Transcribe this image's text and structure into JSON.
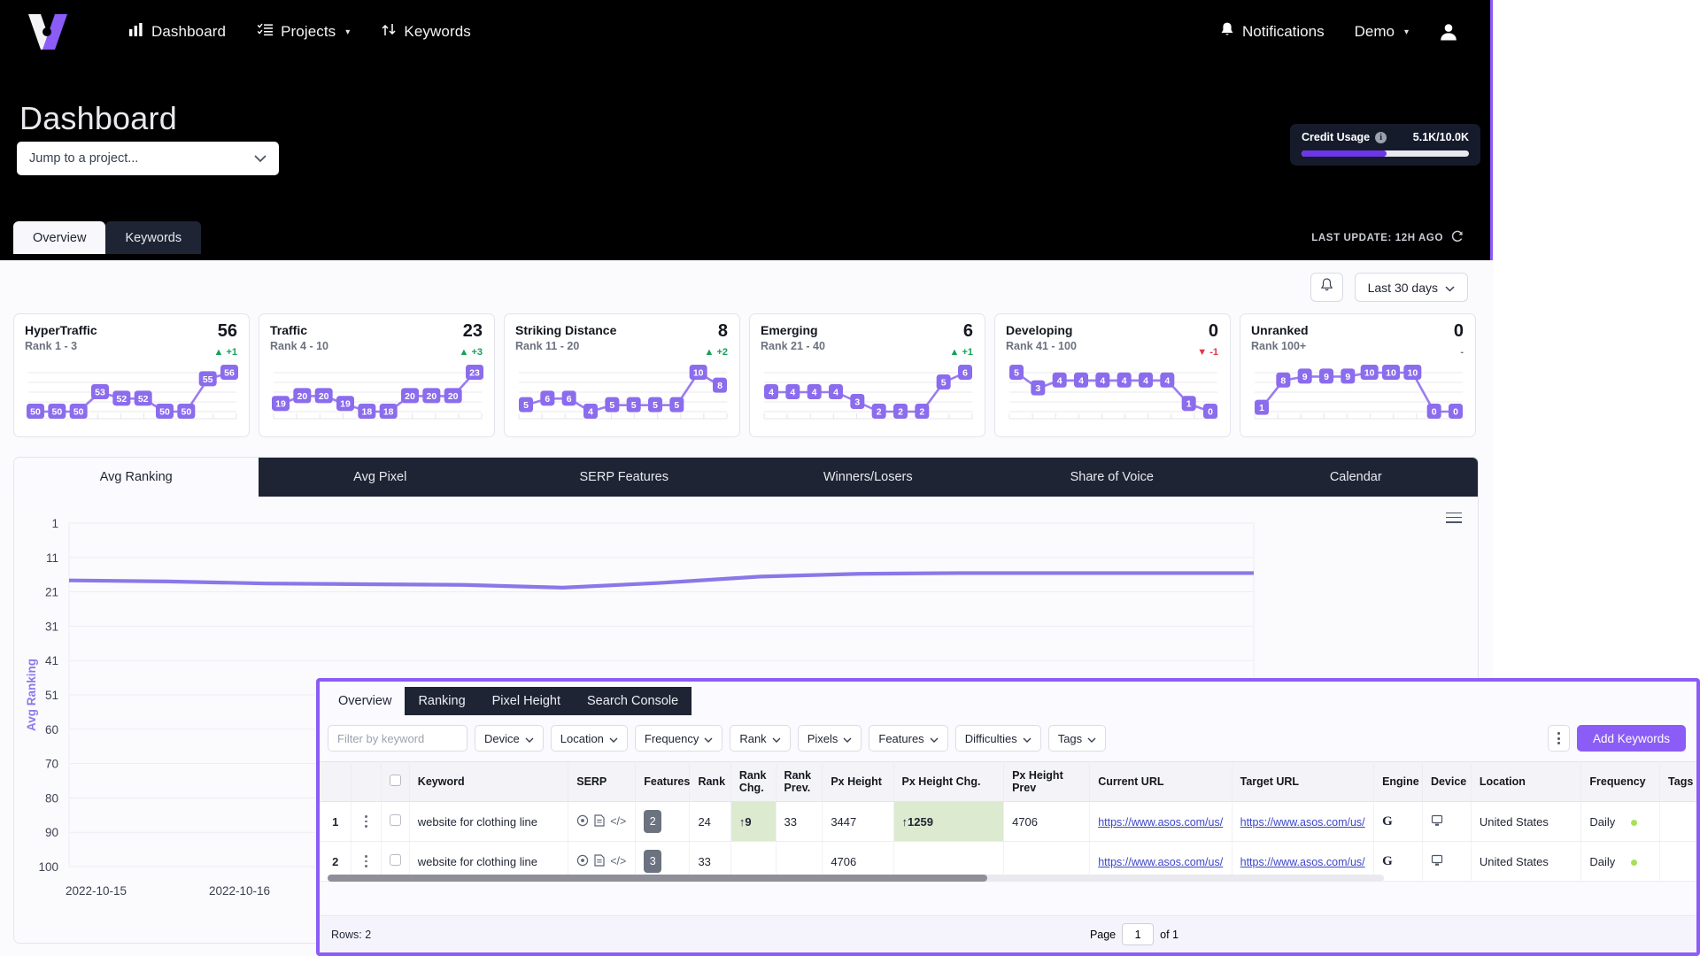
{
  "header": {
    "logo_name": "x-logo",
    "nav": [
      {
        "label": "Dashboard",
        "icon": "bar-chart-icon",
        "caret": false
      },
      {
        "label": "Projects",
        "icon": "list-check-icon",
        "caret": true,
        "caret_glyph": "▾"
      },
      {
        "label": "Keywords",
        "icon": "sliders-icon",
        "caret": false
      }
    ],
    "notifications_label": "Notifications",
    "notifications_icon": "bell-icon",
    "account_label": "Demo",
    "account_caret": "▾",
    "avatar_icon": "user-avatar-icon"
  },
  "page": {
    "title": "Dashboard",
    "project_select_value": "Jump to a project...",
    "project_select_caret": "⌄"
  },
  "credit": {
    "label": "Credit Usage",
    "info_glyph": "i",
    "value": "5.1K/10.0K",
    "percent": 51,
    "fill_color": "#6d36e8"
  },
  "dash_tabs": [
    {
      "label": "Overview",
      "active": true
    },
    {
      "label": "Keywords",
      "active": false
    }
  ],
  "last_update": {
    "text": "LAST UPDATE: 12H AGO",
    "icon": "refresh-icon"
  },
  "toolbar": {
    "bell_icon": "bell-outline-icon",
    "range_label": "Last 30 days",
    "range_caret": "⌄"
  },
  "kpi_cards": [
    {
      "title": "HyperTraffic",
      "subtitle": "Rank 1 - 3",
      "value": "56",
      "change": "+1",
      "dir": "up",
      "arrow": "▲",
      "series": [
        50,
        50,
        50,
        53,
        52,
        52,
        50,
        50,
        55,
        56
      ]
    },
    {
      "title": "Traffic",
      "subtitle": "Rank 4 - 10",
      "value": "23",
      "change": "+3",
      "dir": "up",
      "arrow": "▲",
      "series": [
        19,
        20,
        20,
        19,
        18,
        18,
        20,
        20,
        20,
        23
      ]
    },
    {
      "title": "Striking Distance",
      "subtitle": "Rank 11 - 20",
      "value": "8",
      "change": "+2",
      "dir": "up",
      "arrow": "▲",
      "series": [
        5,
        6,
        6,
        4,
        5,
        5,
        5,
        5,
        10,
        8
      ]
    },
    {
      "title": "Emerging",
      "subtitle": "Rank 21 - 40",
      "value": "6",
      "change": "+1",
      "dir": "up",
      "arrow": "▲",
      "series": [
        4,
        4,
        4,
        4,
        3,
        2,
        2,
        2,
        5,
        6
      ]
    },
    {
      "title": "Developing",
      "subtitle": "Rank 41 - 100",
      "value": "0",
      "change": "-1",
      "dir": "down",
      "arrow": "▼",
      "series": [
        5,
        3,
        4,
        4,
        4,
        4,
        4,
        4,
        1,
        0
      ]
    },
    {
      "title": "Unranked",
      "subtitle": "Rank 100+",
      "value": "0",
      "change": "-",
      "dir": "flat",
      "arrow": "",
      "series": [
        1,
        8,
        9,
        9,
        9,
        10,
        10,
        10,
        0,
        0
      ]
    }
  ],
  "chart_tabs": [
    {
      "label": "Avg Ranking",
      "active": true
    },
    {
      "label": "Avg Pixel",
      "active": false
    },
    {
      "label": "SERP Features",
      "active": false
    },
    {
      "label": "Winners/Losers",
      "active": false
    },
    {
      "label": "Share of Voice",
      "active": false
    },
    {
      "label": "Calendar",
      "active": false
    }
  ],
  "chart_data": {
    "type": "line",
    "title": "",
    "xlabel": "",
    "ylabel": "Avg Ranking",
    "x": [
      "2022-10-15",
      "2022-10-16"
    ],
    "tick_labels_y": [
      "1",
      "11",
      "21",
      "31",
      "41",
      "51",
      "60",
      "70",
      "80",
      "90",
      "100"
    ],
    "ylim": [
      1,
      100
    ],
    "y_inverted": true,
    "grid": true,
    "legend": "none",
    "line_color": "#8b77e8",
    "series": [
      {
        "name": "Avg Ranking",
        "values": [
          17.5,
          17.8,
          18.4,
          18.6,
          18.8,
          19.6,
          18.2,
          16.4,
          15.6,
          15.4,
          15.4,
          15.4,
          15.4
        ]
      }
    ]
  },
  "keyword_panel": {
    "tabs": [
      {
        "label": "Overview",
        "active": true
      },
      {
        "label": "Ranking",
        "active": false
      },
      {
        "label": "Pixel Height",
        "active": false
      },
      {
        "label": "Search Console",
        "active": false
      }
    ],
    "filter_placeholder": "Filter by keyword",
    "filter_value": "",
    "dropdowns": [
      "Device",
      "Location",
      "Frequency",
      "Rank",
      "Pixels",
      "Features",
      "Difficulties",
      "Tags"
    ],
    "dropdown_caret": "⌄",
    "kebab_icon": "vertical-dots-icon",
    "add_keywords_label": "Add Keywords",
    "columns": [
      "",
      "",
      "",
      "Keyword",
      "SERP",
      "Features",
      "Rank",
      "Rank Chg.",
      "Rank Prev.",
      "Px Height",
      "Px Height Chg.",
      "Px Height Prev",
      "Current URL",
      "Target URL",
      "Engine",
      "Device",
      "Location",
      "Frequency",
      "Tags"
    ],
    "rows": [
      {
        "index": "1",
        "keyword": "website for clothing line",
        "features": "2",
        "rank": "24",
        "rank_chg": "↑9",
        "rank_chg_highlight": true,
        "rank_prev": "33",
        "px_height": "3447",
        "px_height_chg": "↑1259",
        "px_height_chg_highlight": true,
        "px_height_prev": "4706",
        "current_url": "https://www.asos.com/us/",
        "target_url": "https://www.asos.com/us/",
        "engine": "G",
        "device": "desktop-icon",
        "location": "United States",
        "frequency": "Daily",
        "tags": ""
      },
      {
        "index": "2",
        "keyword": "website for clothing line",
        "features": "3",
        "rank": "33",
        "rank_chg": "",
        "rank_chg_highlight": false,
        "rank_prev": "",
        "px_height": "4706",
        "px_height_chg": "",
        "px_height_chg_highlight": false,
        "px_height_prev": "",
        "current_url": "https://www.asos.com/us/",
        "target_url": "https://www.asos.com/us/",
        "engine": "G",
        "device": "desktop-icon",
        "location": "United States",
        "frequency": "Daily",
        "tags": ""
      }
    ],
    "footer": {
      "rows_label": "Rows: 2",
      "page_label": "Page",
      "page_value": "1",
      "of_label": "of 1"
    }
  },
  "colors": {
    "accent": "#8b5cf6",
    "dark": "#1e2433",
    "highlight": "#dcead0"
  }
}
